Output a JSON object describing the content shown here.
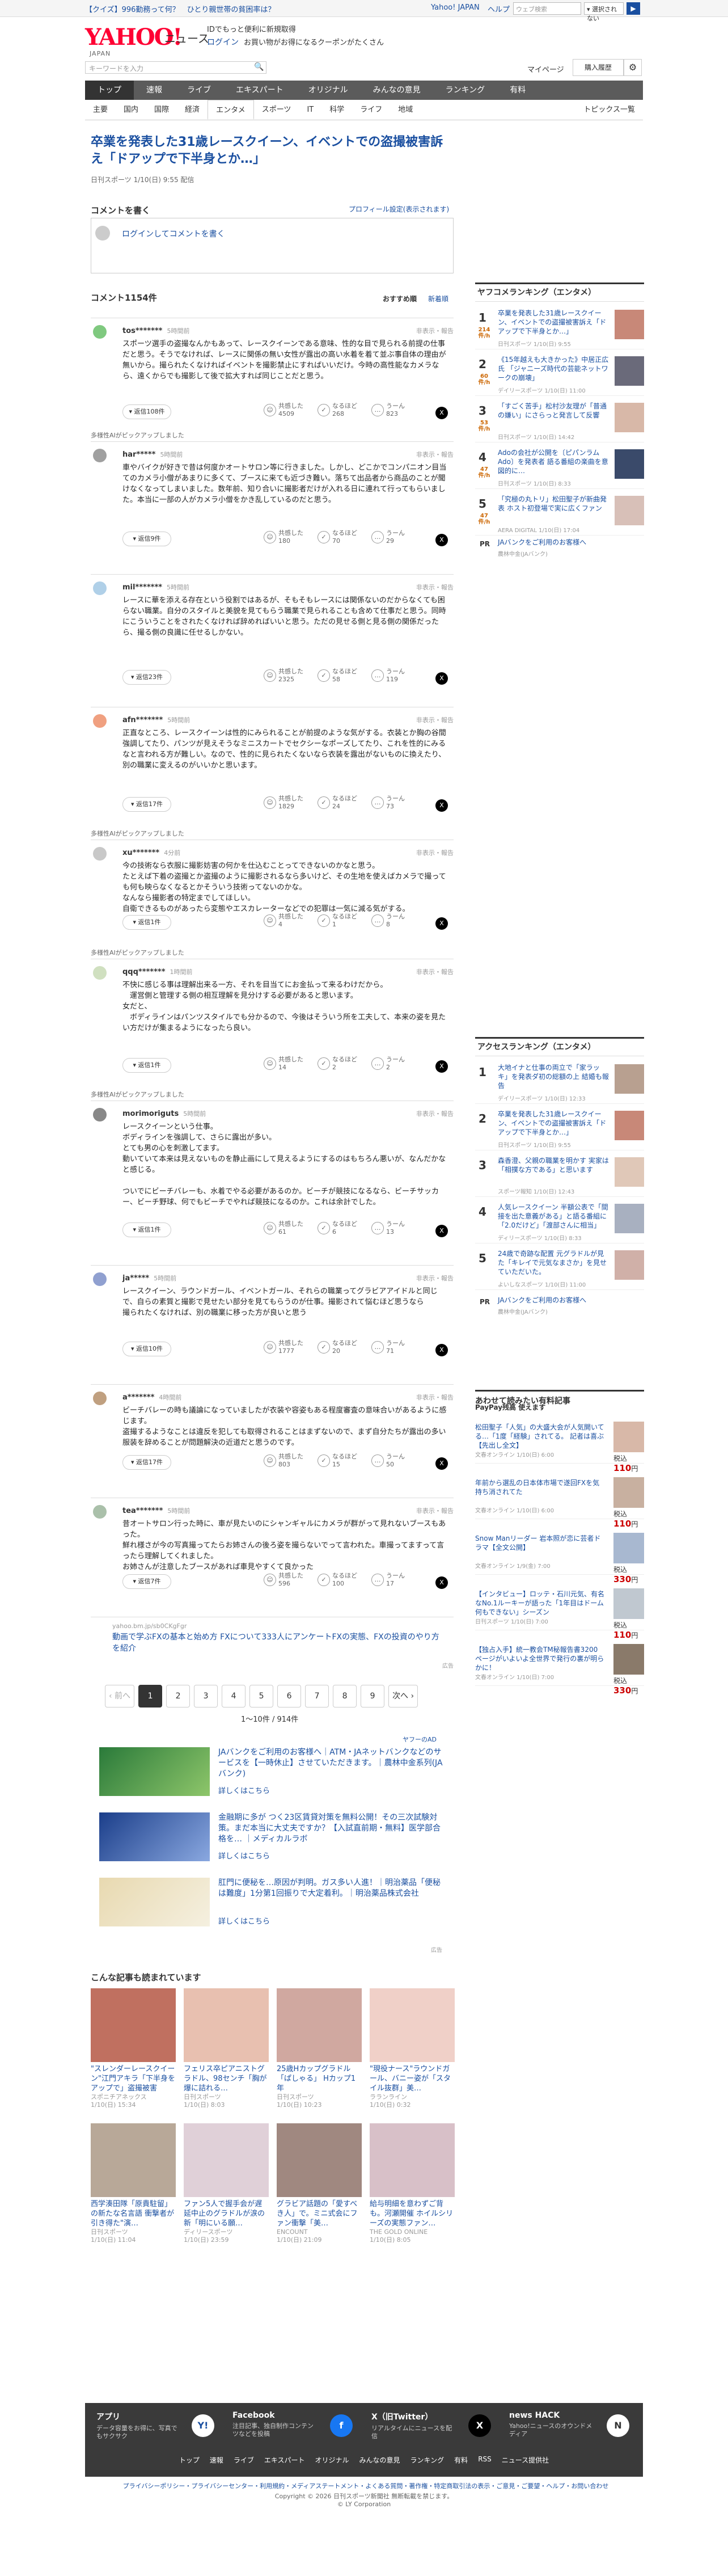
{
  "topbar": {
    "promo": "【クイズ】996勤務って何？　ひとり親世帯の貧困率は？",
    "yahoo_japan": "Yahoo! JAPAN",
    "help": "ヘルプ",
    "search_placeholder": "ウェブ検索",
    "search_button": "▾ 選択されない",
    "go": "▶"
  },
  "header": {
    "logo": "YAHOO!",
    "logo_sub": "JAPAN",
    "service": "ニュース",
    "note": "IDでもっと便利に新規取得",
    "login": "ログイン",
    "login_note": "お買い物がお得になるクーポンがたくさん"
  },
  "search": {
    "placeholder": "キーワードを入力",
    "mypage": "マイページ",
    "purchase": "購入履歴"
  },
  "nav": [
    "トップ",
    "速報",
    "ライブ",
    "エキスパート",
    "オリジナル",
    "みんなの意見",
    "ランキング",
    "有料"
  ],
  "subnav": [
    "主要",
    "国内",
    "国際",
    "経済",
    "エンタメ",
    "スポーツ",
    "IT",
    "科学",
    "ライフ",
    "地域"
  ],
  "subnav_right": "トピックス一覧",
  "article": {
    "title": "卒業を発表した31歳レースクイーン、イベントでの盗撮被害訴え「ドアップで下半身とか…」",
    "meta": "日刊スポーツ 1/10(日) 9:55 配信"
  },
  "comment_form": {
    "heading": "コメントを書く",
    "profile_link": "プロフィール設定(表示されます)",
    "placeholder": "ログインしてコメントを書く"
  },
  "list": {
    "heading": "コメント1154件",
    "sort_recommended": "おすすめ順",
    "sort_new": "新着順"
  },
  "comments": [
    {
      "user": "tos*******",
      "time": "5時間前",
      "ai": "",
      "ops": "非表示・報告",
      "body": "スポーツ選手の盗撮なんかもあって、レースクイーンである意味、性的な目で見られる前提の仕事だと思う。そうでなければ、レースに関係の無い女性が露出の高い水着を着て並ぶ事自体の理由が無いから。撮られたくなければイベントを撮影禁止にすればいいだけ。今時の高性能なカメラなら、遠くからでも撮影して後で拡大すれば同じことだと思う。",
      "reply": "返信108件",
      "r1": "共感した",
      "c1": "4509",
      "r2": "なるほど",
      "c2": "268",
      "r3": "うーん",
      "c3": "823"
    },
    {
      "user": "har*****",
      "time": "5時間前",
      "ai": "多様性AIがピックアップしました",
      "ops": "非表示・報告",
      "body": "車やバイクが好きで昔は何度かオートサロン等に行きました。しかし、どこかでコンパニオン目当てのカメラ小僧があまりに多くて、ブースに来ても近づき難い。落ちて出品者から商品のことが聞けなくなってしまいました。数年前、知り合いに撮影者だけが入れる日に連れて行ってもらいました。本当に一部の人がカメラ小僧をかき乱しているのだと思う。",
      "reply": "返信9件",
      "r1": "共感した",
      "c1": "180",
      "r2": "なるほど",
      "c2": "70",
      "r3": "うーん",
      "c3": "29"
    },
    {
      "user": "mil*******",
      "time": "5時間前",
      "ai": "",
      "ops": "非表示・報告",
      "body": "レースに華を添える存在という役割ではあるが、そもそもレースには関係ないのだからなくても困らない職業。自分のスタイルと美貌を見てもらう職業で見られることも含めて仕事だと思う。同時にこういうことをされたくなければ辞めればいいと思う。ただの見せる側と見る側の関係だったら、撮る側の良識に任せるしかない。",
      "reply": "返信23件",
      "r1": "共感した",
      "c1": "2325",
      "r2": "なるほど",
      "c2": "58",
      "r3": "うーん",
      "c3": "119"
    },
    {
      "user": "afn*******",
      "time": "5時間前",
      "ai": "",
      "ops": "非表示・報告",
      "body": "正直なところ、レースクイーンは性的にみられることが前提のような気がする。衣装とか胸の谷間強調してたり、パンツが見えそうなミニスカートでセクシーなポーズしてたり、これを性的にみるなと言われる方が難しい。なので、性的に見られたくないなら衣装を露出がないものに換えたり、別の職業に変えるのがいいかと思います。",
      "reply": "返信17件",
      "r1": "共感した",
      "c1": "1829",
      "r2": "なるほど",
      "c2": "24",
      "r3": "うーん",
      "c3": "73"
    },
    {
      "user": "xu*******",
      "time": "4分前",
      "ai": "多様性AIがピックアップしました",
      "ops": "非表示・報告",
      "body": "今の技術なら衣服に撮影妨害の何かを仕込むことってできないのかなと思う。\nたとえば下着の盗撮とか盗撮のように撮影されるなら多いけど、その生地を使えばカメラで撮っても何も映らなくなるとかそういう技術ってないのかな。\nなんなら撮影者の特定までしてほしい。\n自衛できるものがあったら変態やエスカレーターなどでの犯罪は一気に減る気がする。",
      "reply": "返信1件",
      "r1": "共感した",
      "c1": "4",
      "r2": "なるほど",
      "c2": "1",
      "r3": "うーん",
      "c3": "8"
    },
    {
      "user": "qqq*******",
      "time": "1時間前",
      "ai": "多様性AIがピックアップしました",
      "ops": "非表示・報告",
      "body": "不快に感じる事は理解出来る一方、それを目当てにお金払って来るわけだから。\n　運営側と管理する側の相互理解を見分けする必要があると思います。\n女だと、\n　ボディラインはパンツスタイルでも分かるので、今後はそういう所を工夫して、本来の姿を見たい方だけが集まるようになったら良い。",
      "reply": "返信1件",
      "r1": "共感した",
      "c1": "14",
      "r2": "なるほど",
      "c2": "2",
      "r3": "うーん",
      "c3": "2"
    },
    {
      "user": "morimoriguts",
      "time": "5時間前",
      "ai": "多様性AIがピックアップしました",
      "ops": "非表示・報告",
      "body": "レースクイーンという仕事。\nボディラインを強調して、さらに露出が多い。\nとても男の心を刺激してます。\n動いていて本来は見えないものを静止画にして見えるようにするのはもちろん悪いが、なんだかなと感じる。\n\nついでにビーチバレーも、水着でやる必要があるのか。ビーチが競技になるなら、ビーチサッカー、ビーチ野球、何でもビーチでやれば競技になるのか。これは余計でした。",
      "reply": "返信1件",
      "r1": "共感した",
      "c1": "61",
      "r2": "なるほど",
      "c2": "6",
      "r3": "うーん",
      "c3": "13"
    },
    {
      "user": "ja*****",
      "time": "5時間前",
      "ai": "",
      "ops": "非表示・報告",
      "body": "レースクイーン、ラウンドガール、イベントガール、それらの職業ってグラビアアイドルと同じで、自らの素質と撮影で見せたい部分を見てもらうのが仕事。撮影されて悩むほど思うなら\n撮られたくなければ、別の職業に移った方が良いと思う",
      "reply": "返信10件",
      "r1": "共感した",
      "c1": "1777",
      "r2": "なるほど",
      "c2": "20",
      "r3": "うーん",
      "c3": "71"
    },
    {
      "user": "a*******",
      "time": "4時間前",
      "ai": "",
      "ops": "非表示・報告",
      "body": "ビーチバレーの時も議論になっていましたが衣装や容姿もある程度審査の意味合いがあるように感じます。\n盗撮するようなことは違反を犯しても取得されることはまずないので、まず自分たちが露出の多い服装を辞めることが問題解決の近道だと思うのです。",
      "reply": "返信17件",
      "r1": "共感した",
      "c1": "803",
      "r2": "なるほど",
      "c2": "15",
      "r3": "うーん",
      "c3": "50"
    },
    {
      "user": "tea*******",
      "time": "5時間前",
      "ai": "",
      "ops": "非表示・報告",
      "body": "昔オートサロン行った時に、車が見たいのにシャンギャルにカメラが群がって見れないブースもあった。\n鮮れ様さが今の写真撮ってたらお姉さんの後ろ姿を撮らないでって言われた。車撮ってますって言ったら理解してくれました。\nお姉さんが注意したブースがあれば車見やすくて良かった",
      "reply": "返信7件",
      "r1": "共感した",
      "c1": "596",
      "r2": "なるほど",
      "c2": "100",
      "r3": "うーん",
      "c3": "17"
    }
  ],
  "sponsor": {
    "source": "yahoo.bm.jp/sb0CKgFgr",
    "text": "動画で学ぶFXの基本と始め方 FXについて333人にアンケートFXの実態、FXの投資のやり方を紹介",
    "ad_label": "広告"
  },
  "pager": {
    "prev": "‹ 前へ",
    "pages": [
      "1",
      "2",
      "3",
      "4",
      "5",
      "6",
      "7",
      "8",
      "9"
    ],
    "next": "次へ ›",
    "info": "1〜10件 / 914件"
  },
  "ads": {
    "label": "ヤフーのAD",
    "items": [
      {
        "title": "JAバンクをご利用のお客様へ｜ATM・JAネットバンクなどのサービスを【一時休止】させていただきます。｜農林中金系列(JAバンク)",
        "more": "詳しくはこちら"
      },
      {
        "title": "金融期に多が つく23区賃貸対策を無料公開！その三次試験対策。まだ本当に大丈夫ですか？【入試直前期・無料】医学部合格を… ｜メディカルラボ",
        "more": "詳しくはこちら"
      },
      {
        "title": "肛門に便秘を…原因が判明。ガス多い人進！｜明治薬品「便秘は難度」1分第1回振りで大定着利。｜明治薬品株式会社",
        "more": "詳しくはこちら"
      }
    ],
    "ad_label": "広告"
  },
  "recommended": {
    "heading": "こんな記事も読まれています",
    "items": [
      {
        "title": "\"スレンダーレースクイーン\"江門アキラ「下半身をアップで」盗撮被害",
        "source": "スポニチアネックス",
        "time": "1/10(日) 15:34"
      },
      {
        "title": "フェリス卒ピアニストグラドル、98センチ「胸が爆に詰れる…",
        "source": "日刊スポーツ",
        "time": "1/10(日) 8:03"
      },
      {
        "title": "25歳Hカップグラドル「ぱしゃる」 Hカップ1年",
        "source": "日刊スポーツ",
        "time": "1/10(日) 10:23"
      },
      {
        "title": "\"現役ナース\"ラウンドガール、バニー姿が「スタイル抜群」美…",
        "source": "ラランライン",
        "time": "1/10(日) 0:32"
      },
      {
        "title": "西学湊田隊「原貴駐留」の新たな名言語 衝撃者が引き得た\"演…",
        "source": "日刊スポーツ",
        "time": "1/10(日) 11:04"
      },
      {
        "title": "ファン5人で握手会が遅延中止のグラドルが涙の新「明にいる願…",
        "source": "ディリースポーツ",
        "time": "1/10(日) 23:59"
      },
      {
        "title": "グラビア話題の「愛すべき人」で。ミニ式会にファン衝撃「美…",
        "source": "ENCOUNT",
        "time": "1/10(日) 21:09"
      },
      {
        "title": "給与明細を意わずご背も。河瀬開催 ホイルシリーズの実態ファン…",
        "source": "THE GOLD ONLINE",
        "time": "1/10(日) 8:05"
      }
    ]
  },
  "sidebar": {
    "ranking_heading": "ヤフコメランキング（エンタメ）",
    "ranking": [
      {
        "n": "1",
        "badge": "214\n件/h",
        "title": "卒業を発表した31歳レースクイーン、イベントでの盗撮被害訴え「ドアップで下半身とか…」",
        "source": "日刊スポーツ 1/10(日) 9:55"
      },
      {
        "n": "2",
        "badge": "60\n件/h",
        "title": "《15年越えも大きかった》中居正広氏 「ジャニーズ時代の芸能ネットワークの崩壊」",
        "source": "デイリースポーツ 1/10(日) 11:00"
      },
      {
        "n": "3",
        "badge": "53\n件/h",
        "title": "「すごく苦手」松村沙友理が「普通の嫌い」にさらっと発言して反響",
        "source": "日刊スポーツ 1/10(日) 14:42"
      },
      {
        "n": "4",
        "badge": "47\n件/h",
        "title": "Adoの会社が公開を〔ピパンラムAdo〕を発表者 語る番組の楽曲を意図的に…",
        "source": "日刊スポーツ 1/10(日) 8:33"
      },
      {
        "n": "5",
        "badge": "47\n件/h",
        "title": "「究極の丸トリ」松田聖子が新曲発表 ホスト初登場で実に広くファン",
        "source": "AERA DIGITAL 1/10(日) 17:04"
      }
    ],
    "pr": {
      "label": "PR",
      "title": "JAバンクをご利用のお客様へ",
      "source": "農林中金(JAバンク)"
    },
    "access_heading": "アクセスランキング（エンタメ）",
    "access": [
      {
        "n": "1",
        "title": "大地イナと仕事の両立で「家ラッキ」を発表ダ初の総額の上 結婚も報告",
        "source": "デイリースポーツ 1/10(日) 12:33"
      },
      {
        "n": "2",
        "title": "卒業を発表した31歳レースクイーン、イベントでの盗撮被害訴え「ドアップで下半身とか…」",
        "source": "日刊スポーツ 1/10(日) 9:55"
      },
      {
        "n": "3",
        "title": "森香澄、父親の職業を明かす 実家は「相撲な方である」と思います",
        "source": "スポーツ報知 1/10(日) 12:43"
      },
      {
        "n": "4",
        "title": "人気レースクイーン 半額公表で「間接を出た意義がある」と語る番組に「2.0だけど」「渡部さんに相当」",
        "source": "ディリースポーツ 1/10(日) 8:33"
      },
      {
        "n": "5",
        "title": "24歳で奇跡な配置 元グラドルが見た「キレイで元気なまさか」を見せていただいた。",
        "source": "よいしなスポーツ 1/10(日) 11:00"
      }
    ],
    "pr2": {
      "label": "PR",
      "title": "JAバンクをご利用のお客様へ",
      "source": "農林中金(JAバンク)"
    },
    "shop_heading": "あわせて読みたい有料記事",
    "paypay": "PayPay残高 使えます",
    "shop": [
      {
        "title": "松田聖子「人気」の大盛大会が人気開いてる…「1度「経験」されてる。 記者は喜ぶ【先出し全文】",
        "source": "文春オンライン 1/10(日) 6:00",
        "price": "110"
      },
      {
        "title": "年前から選乱の日本体市場で遂回FXを気持ち消されてた",
        "source": "文春オンライン 1/10(日) 6:00",
        "price": "110"
      },
      {
        "title": "Snow Manリーダー 岩本照が恋に芸者ドラマ【全文公開】",
        "source": "文春オンライン 1/9(金) 7:00",
        "price": "330"
      },
      {
        "title": "【インタビュー】ロッテ・石川元気、有名なNo.1ルーキーが語った「1年目はドーム何もできない」シーズン",
        "source": "日刊スポーツ 1/10(日) 7:00",
        "price": "110"
      },
      {
        "title": "【独占入手】統一教会TM秘報告書3200ページがいよいよ全世界で発行の裏が明らかに！",
        "source": "文春オンライン 1/10(日) 7:00",
        "price": "330"
      }
    ]
  },
  "footer": {
    "app_h": "アプリ",
    "app_d": "データ容量をお得に、写真でもサクサク",
    "fb_h": "Facebook",
    "fb_d": "注目記事、独自制作コンテンツなどを投稿",
    "x_h": "X（旧Twitter）",
    "x_d": "リアルタイムにニュースを配信",
    "hack_h": "news HACK",
    "hack_d": "Yahoo!ニュースのオウンドメディア",
    "nav": [
      "トップ",
      "速報",
      "ライブ",
      "エキスパート",
      "オリジナル",
      "みんなの意見",
      "ランキング",
      "有料",
      "RSS",
      "ニュース提供社"
    ],
    "links": "プライバシーポリシー・プライバシーセンター・利用規約・メディアステートメント・よくある質問・著作権・特定商取引法の表示・ご意見・ご要望・ヘルプ・お問い合わせ",
    "copy1": "Copyright © 2026 日刊スポーツ新聞社 無断転載を禁じます。",
    "copy2": "© LY Corporation"
  },
  "colors": {
    "link": "#1a4fa0",
    "logo": "#ff0033",
    "nav": "#5b5b5b"
  }
}
